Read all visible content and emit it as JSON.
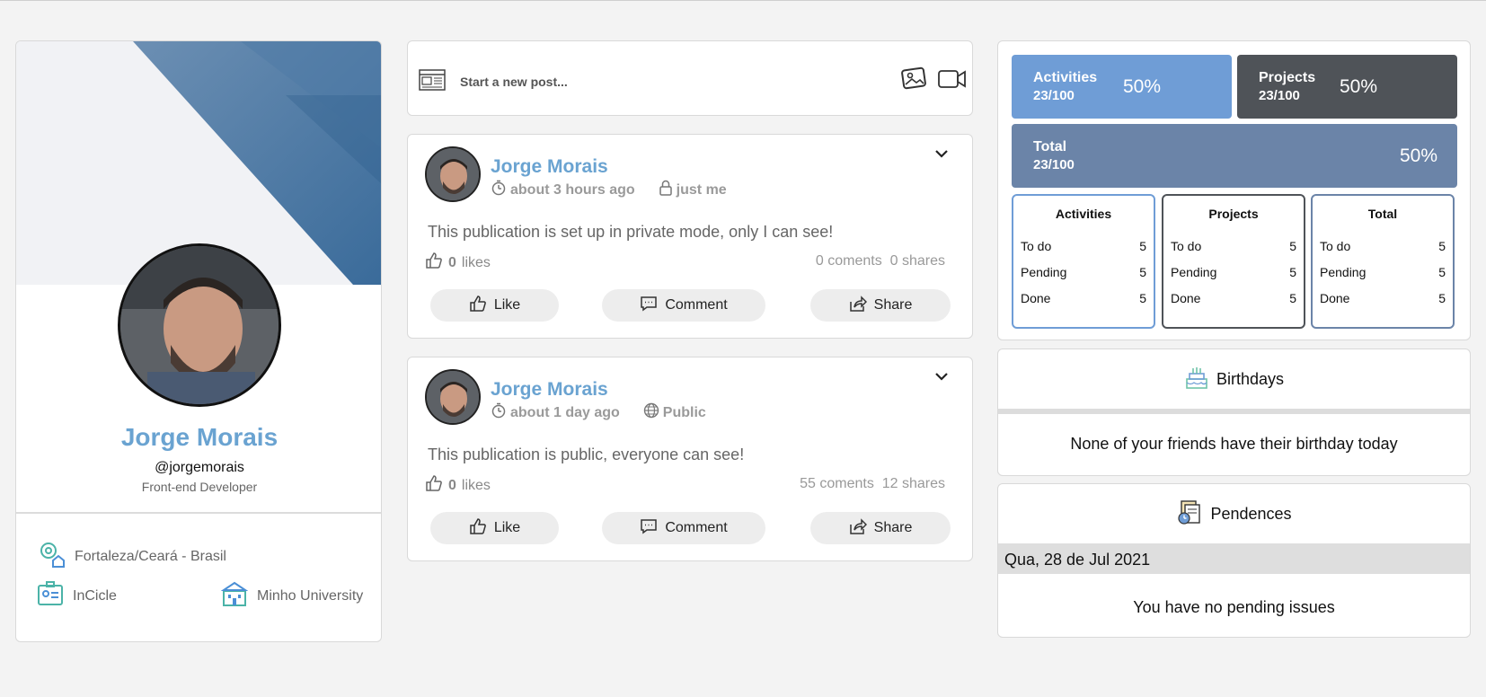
{
  "profile": {
    "name": "Jorge Morais",
    "handle": "@jorgemorais",
    "role": "Front-end Developer",
    "location": "Fortaleza/Ceará - Brasil",
    "company": "InCicle",
    "university": "Minho University"
  },
  "composer": {
    "placeholder": "Start a new post..."
  },
  "posts": [
    {
      "author": "Jorge Morais",
      "time": "about 3 hours ago",
      "visibility": "just me",
      "text": "This publication is set up in private mode, only I can see!",
      "likes_count": "0",
      "likes_label": "likes",
      "stats": "0 coments  0 shares",
      "like_label": "Like",
      "comment_label": "Comment",
      "share_label": "Share"
    },
    {
      "author": "Jorge Morais",
      "time": "about 1 day ago",
      "visibility": "Public",
      "text": "This publication is public, everyone can see!",
      "likes_count": "0",
      "likes_label": "likes",
      "stats": "55 coments  12 shares",
      "like_label": "Like",
      "comment_label": "Comment",
      "share_label": "Share"
    }
  ],
  "summary": {
    "activities": {
      "label": "Activities",
      "count": "23/100",
      "percent": "50%",
      "color": "#6f9dd6"
    },
    "projects": {
      "label": "Projects",
      "count": "23/100",
      "percent": "50%",
      "color": "#4f5358"
    },
    "total": {
      "label": "Total",
      "count": "23/100",
      "percent": "50%",
      "color": "#6b84a8"
    }
  },
  "tables": [
    {
      "title": "Activities",
      "border": "#6f9dd6",
      "rows": [
        {
          "label": "To do",
          "value": "5"
        },
        {
          "label": "Pending",
          "value": "5"
        },
        {
          "label": "Done",
          "value": "5"
        }
      ]
    },
    {
      "title": "Projects",
      "border": "#4f5358",
      "rows": [
        {
          "label": "To do",
          "value": "5"
        },
        {
          "label": "Pending",
          "value": "5"
        },
        {
          "label": "Done",
          "value": "5"
        }
      ]
    },
    {
      "title": "Total",
      "border": "#6b84a8",
      "rows": [
        {
          "label": "To do",
          "value": "5"
        },
        {
          "label": "Pending",
          "value": "5"
        },
        {
          "label": "Done",
          "value": "5"
        }
      ]
    }
  ],
  "birthdays": {
    "title": "Birthdays",
    "empty": "None of your friends have their birthday today"
  },
  "pendences": {
    "title": "Pendences",
    "date": "Qua, 28 de Jul 2021",
    "empty": "You have no pending issues"
  }
}
